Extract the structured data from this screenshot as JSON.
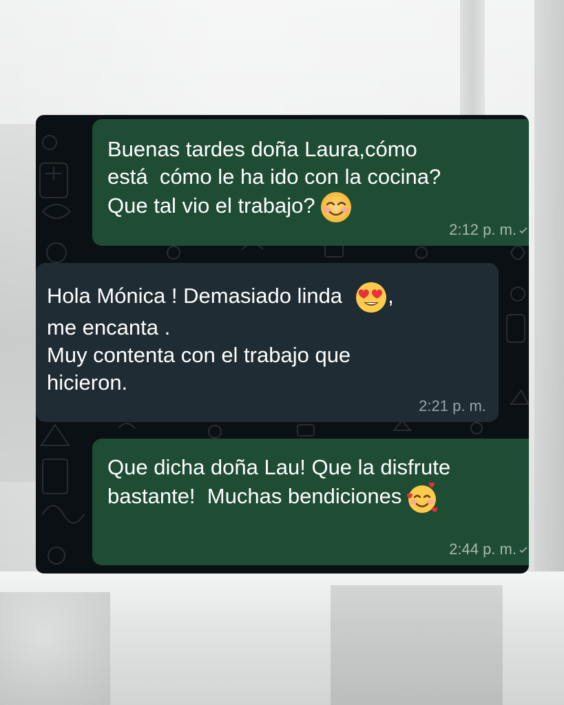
{
  "messages": [
    {
      "direction": "outgoing",
      "line1": "Buenas tardes doña Laura,cómo",
      "line2": "está  cómo le ha ido con la cocina?",
      "line3": "Que tal vio el trabajo?",
      "emoji": "smiling-face-with-blush-emoji",
      "time": "2:12 p. m."
    },
    {
      "direction": "incoming",
      "line1": "Hola Mónica ! Demasiado linda",
      "line1_suffix": ",",
      "line2": "me encanta .",
      "line3": "Muy contenta con el trabajo que",
      "line4": "hicieron.",
      "emoji": "heart-eyes-emoji",
      "time": "2:21 p. m."
    },
    {
      "direction": "outgoing",
      "line1": "Que dicha doña Lau! Que la disfrute",
      "line2": "bastante!  Muchas bendiciones",
      "emoji": "smiling-face-with-hearts-emoji",
      "time": "2:44 p. m."
    }
  ],
  "colors": {
    "outgoing_bubble": "#1f4d33",
    "incoming_bubble": "#202c33",
    "chat_background": "#0b1014"
  }
}
